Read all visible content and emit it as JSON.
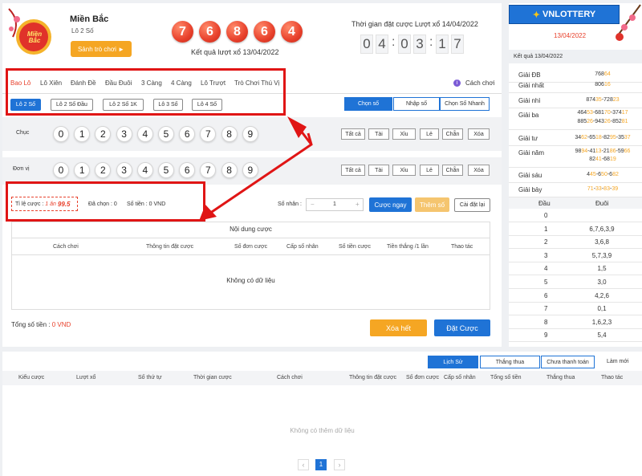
{
  "header": {
    "region": "Miền Bắc",
    "game": "Lô 2 Số",
    "lobby_button": "Sảnh trò chơi ►",
    "badge_line1": "Miền",
    "badge_line2": "Bắc",
    "result_balls": [
      "7",
      "6",
      "8",
      "6",
      "4"
    ],
    "result_caption": "Kết quả lượt xổ 13/04/2022",
    "bet_time_label": "Thời gian đặt cược Lượt xổ 14/04/2022",
    "countdown": [
      "0",
      "4",
      ":",
      "0",
      "3",
      ":",
      "1",
      "7"
    ]
  },
  "tabs": [
    "Bao Lô",
    "Lô Xiên",
    "Đánh Đề",
    "Đầu Đuôi",
    "3 Càng",
    "4 Càng",
    "Lô Trượt",
    "Trò Chơi Thú Vị"
  ],
  "howto": "Cách chơi",
  "subtabs": [
    "Lô 2 Số",
    "Lô 2 Số Đầu",
    "Lô 2 Số 1K",
    "Lô 3 Số",
    "Lô 4 Số"
  ],
  "modes": [
    "Chọn số",
    "Nhập số",
    "Chọn Số Nhanh"
  ],
  "rows": [
    {
      "label": "Chục"
    },
    {
      "label": "Đơn vị"
    }
  ],
  "digits": [
    "0",
    "1",
    "2",
    "3",
    "4",
    "5",
    "6",
    "7",
    "8",
    "9"
  ],
  "quick": [
    "Tất cả",
    "Tài",
    "Xỉu",
    "Lẻ",
    "Chẵn",
    "Xóa"
  ],
  "odds": {
    "label": "Tỉ lệ cược :",
    "value_prefix": "1 ăn",
    "value": "99.5",
    "selected": "Đã chọn : 0",
    "amount": "Số tiền : 0 VND"
  },
  "multiplier": {
    "label": "Số nhân :",
    "minus": "−",
    "value": "1",
    "plus": "+"
  },
  "actions": {
    "bet_now": "Cược ngay",
    "add": "Thêm số",
    "reset": "Cài đặt lại",
    "clear": "Xóa hết",
    "place": "Đặt Cược"
  },
  "content": {
    "title": "Nội dung cược",
    "headers": [
      "Cách chơi",
      "Thông tin đặt cược",
      "Số đơn cược",
      "Cấp số nhân",
      "Số tiền cược",
      "Tiền thắng /1 lần",
      "Thao tác"
    ],
    "empty": "Không có dữ liệu"
  },
  "total": {
    "label": "Tổng số tiền :",
    "value": "0 VND"
  },
  "history": {
    "tabs": [
      "Lịch Sử",
      "Thắng thua",
      "Chưa thanh toán"
    ],
    "refresh": "Làm mới",
    "headers": [
      "Kiểu cược",
      "Lượt xổ",
      "Số thứ tự",
      "Thời gian cược",
      "Cách chơi",
      "Thông tin đặt cược",
      "Số đơn cược",
      "Cấp số nhân",
      "Tổng số tiền",
      "Thắng thua",
      "Thao tác"
    ],
    "empty": "Không có thêm dữ liệu",
    "page": "1",
    "prev": "‹",
    "next": "›"
  },
  "results": {
    "logo": "VNLOTTERY",
    "date": "13/04/2022",
    "caption": "Kết quả 13/04/2022",
    "prizes": [
      {
        "name": "Giải ĐB",
        "lines": [
          [
            "768",
            "64"
          ]
        ]
      },
      {
        "name": "Giải nhất",
        "lines": [
          [
            "806",
            "16"
          ]
        ]
      },
      {
        "name": "Giải nhì",
        "lines": [
          [
            "874",
            "35"
          ],
          [
            "-728",
            "23"
          ]
        ]
      },
      {
        "name": "Giải ba",
        "lines": [
          [
            "464",
            "53"
          ],
          [
            "-681",
            "70"
          ],
          [
            "-374",
            "17"
          ]
        ],
        "lines2": [
          [
            "885",
            "26"
          ],
          [
            "-943",
            "26"
          ],
          [
            "-852",
            "81"
          ]
        ]
      },
      {
        "name": "Giải tư",
        "lines": [
          [
            "34",
            "62"
          ],
          [
            "-65",
            "18"
          ],
          [
            "-82",
            "95"
          ],
          [
            "-35",
            "37"
          ]
        ]
      },
      {
        "name": "Giải năm",
        "lines": [
          [
            "98",
            "94"
          ],
          [
            "-41",
            "13"
          ],
          [
            "-21",
            "86"
          ],
          [
            "-59",
            "66"
          ]
        ],
        "lines2": [
          [
            "82",
            "41"
          ],
          [
            "-68",
            "19"
          ]
        ]
      },
      {
        "name": "Giải sáu",
        "lines": [
          [
            "4",
            "45"
          ],
          [
            "-6",
            "50"
          ],
          [
            "-6",
            "82"
          ]
        ]
      },
      {
        "name": "Giải bảy",
        "lines": [
          [
            "",
            "71"
          ],
          [
            "-",
            "33"
          ],
          [
            "-",
            "83"
          ],
          [
            "-",
            "39"
          ]
        ]
      }
    ],
    "table_head": [
      "Đầu",
      "Đuôi"
    ],
    "table": [
      [
        "0",
        ""
      ],
      [
        "1",
        "6,7,6,3,9"
      ],
      [
        "2",
        "3,6,8"
      ],
      [
        "3",
        "5,7,3,9"
      ],
      [
        "4",
        "1,5"
      ],
      [
        "5",
        "3,0"
      ],
      [
        "6",
        "4,2,6"
      ],
      [
        "7",
        "0,1"
      ],
      [
        "8",
        "1,6,2,3"
      ],
      [
        "9",
        "5,4"
      ]
    ]
  },
  "colors": {
    "accent": "#1f73d6",
    "ball": "#e8412c",
    "highlight": "#e8412c",
    "orange": "#f5a623"
  }
}
